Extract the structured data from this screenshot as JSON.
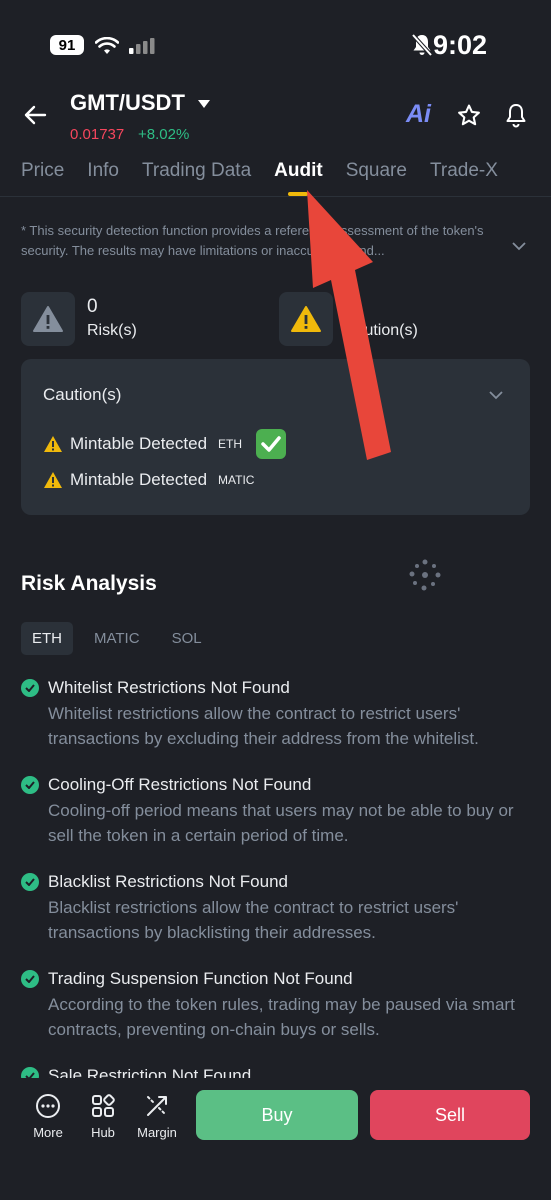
{
  "status_bar": {
    "battery": "91",
    "time": "9:02"
  },
  "header": {
    "pair": "GMT/USDT",
    "price": "0.01737",
    "change": "+8.02%",
    "ai_label": "Ai"
  },
  "tabs": [
    {
      "label": "Price"
    },
    {
      "label": "Info"
    },
    {
      "label": "Trading Data"
    },
    {
      "label": "Audit"
    },
    {
      "label": "Square"
    },
    {
      "label": "Trade-X"
    }
  ],
  "disclaimer": "* This security detection function provides a reference assessment of the token's security. The results may have limitations or inaccuracies and...",
  "stats": {
    "risk_count": "0",
    "risk_label": "Risk(s)",
    "caution_label": "Caution(s)"
  },
  "caution_card": {
    "title": "Caution(s)",
    "items": [
      {
        "label": "Mintable Detected",
        "chain": "ETH"
      },
      {
        "label": "Mintable Detected",
        "chain": "MATIC"
      }
    ]
  },
  "risk_analysis": {
    "title": "Risk Analysis",
    "chains": [
      "ETH",
      "MATIC",
      "SOL"
    ],
    "items": [
      {
        "title": "Whitelist Restrictions Not Found",
        "desc": "Whitelist restrictions allow the contract to restrict users' transactions by excluding their address from the whitelist."
      },
      {
        "title": "Cooling-Off Restrictions Not Found",
        "desc": "Cooling-off period means that users may not be able to buy or sell the token in a certain period of time."
      },
      {
        "title": "Blacklist Restrictions Not Found",
        "desc": "Blacklist restrictions allow the contract to restrict users' transactions by blacklisting their addresses."
      },
      {
        "title": "Trading Suspension Function Not Found",
        "desc": "According to the token rules, trading may be paused via smart contracts, preventing on-chain buys or sells."
      },
      {
        "title": "Sale Restriction Not Found",
        "desc": ""
      }
    ]
  },
  "bottom_bar": {
    "more": "More",
    "hub": "Hub",
    "margin": "Margin",
    "buy": "Buy",
    "sell": "Sell"
  },
  "colors": {
    "background": "#1e2026",
    "card": "#2b3139",
    "green": "#2ebd85",
    "red": "#f6465d",
    "yellow": "#f0b90b",
    "arrow": "#e8463a"
  }
}
